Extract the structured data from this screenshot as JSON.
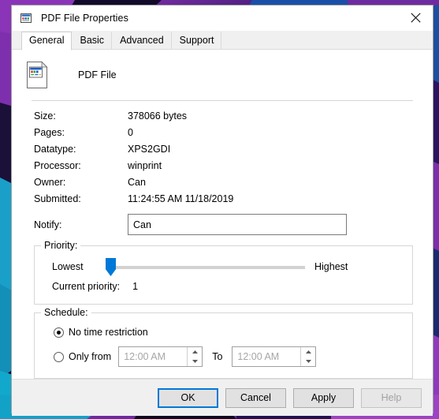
{
  "window": {
    "title": "PDF File Properties",
    "icon": "printer-document-icon",
    "close_label": "✕"
  },
  "tabs": [
    {
      "label": "General",
      "active": true
    },
    {
      "label": "Basic",
      "active": false
    },
    {
      "label": "Advanced",
      "active": false
    },
    {
      "label": "Support",
      "active": false
    }
  ],
  "document": {
    "icon": "file-document-icon",
    "name": "PDF File"
  },
  "properties": [
    {
      "label": "Size:",
      "value": "378066 bytes"
    },
    {
      "label": "Pages:",
      "value": "0"
    },
    {
      "label": "Datatype:",
      "value": "XPS2GDI"
    },
    {
      "label": "Processor:",
      "value": "winprint"
    },
    {
      "label": "Owner:",
      "value": "Can"
    },
    {
      "label": "Submitted:",
      "value": "11:24:55 AM  11/18/2019"
    }
  ],
  "notify": {
    "label": "Notify:",
    "value": "Can",
    "placeholder": ""
  },
  "priority": {
    "group_title": "Priority:",
    "lowest_label": "Lowest",
    "highest_label": "Highest",
    "current_label": "Current priority:",
    "current_value": "1",
    "slider_min": 1,
    "slider_max": 99,
    "slider_value": 1,
    "accent_color": "#0078d7"
  },
  "schedule": {
    "group_title": "Schedule:",
    "no_restriction_label": "No time restriction",
    "no_restriction_selected": true,
    "only_from_label": "Only from",
    "only_from_selected": false,
    "from_time": "12:00 AM",
    "to_label": "To",
    "to_time": "12:00 AM"
  },
  "footer": {
    "ok_label": "OK",
    "cancel_label": "Cancel",
    "apply_label": "Apply",
    "help_label": "Help"
  }
}
